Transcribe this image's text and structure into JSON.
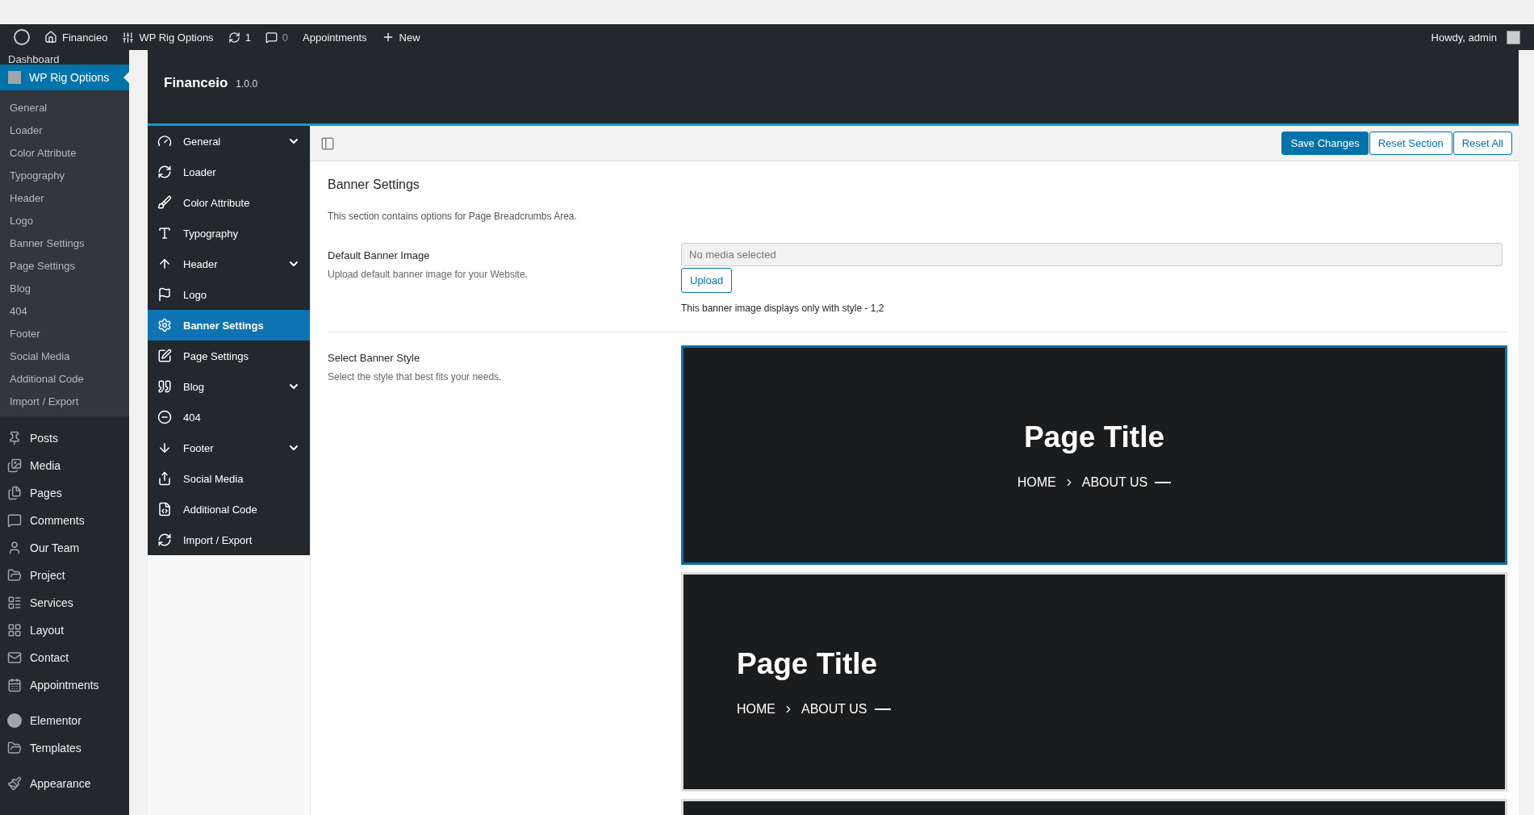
{
  "admin_bar": {
    "site": "Financieo",
    "plugin": "WP Rig Options",
    "updates": "1",
    "comments": "0",
    "appointments": "Appointments",
    "new": "New",
    "greeting": "Howdy, admin"
  },
  "wp_menu": {
    "top_item": "Dashboard",
    "current": {
      "label": "WP Rig Options",
      "selected": true
    },
    "submenu": [
      "General",
      "Loader",
      "Color Attribute",
      "Typography",
      "Header",
      "Logo",
      "Banner Settings",
      "Page Settings",
      "Blog",
      "404",
      "Footer",
      "Social Media",
      "Additional Code",
      "Import / Export"
    ],
    "groups": [
      [
        {
          "label": "Posts",
          "selected": false
        },
        {
          "label": "Media",
          "selected": false
        },
        {
          "label": "Pages",
          "selected": false
        },
        {
          "label": "Comments",
          "selected": false
        },
        {
          "label": "Our Team",
          "selected": false
        },
        {
          "label": "Project",
          "selected": false
        },
        {
          "label": "Services",
          "selected": false
        },
        {
          "label": "Layout",
          "selected": false
        },
        {
          "label": "Contact",
          "selected": false
        },
        {
          "label": "Appointments",
          "selected": false
        }
      ],
      [
        {
          "label": "Elementor",
          "selected": false
        },
        {
          "label": "Templates",
          "selected": false
        }
      ],
      [
        {
          "label": "Appearance",
          "selected": false
        }
      ]
    ]
  },
  "options_header": {
    "title": "Financeio",
    "version": "1.0.0"
  },
  "options_nav": [
    {
      "label": "General",
      "selected": false,
      "expandable": true
    },
    {
      "label": "Loader",
      "selected": false,
      "expandable": false
    },
    {
      "label": "Color Attribute",
      "selected": false,
      "expandable": false
    },
    {
      "label": "Typography",
      "selected": false,
      "expandable": false
    },
    {
      "label": "Header",
      "selected": false,
      "expandable": true
    },
    {
      "label": "Logo",
      "selected": false,
      "expandable": false
    },
    {
      "label": "Banner Settings",
      "selected": true,
      "expandable": false
    },
    {
      "label": "Page Settings",
      "selected": false,
      "expandable": false
    },
    {
      "label": "Blog",
      "selected": false,
      "expandable": true
    },
    {
      "label": "404",
      "selected": false,
      "expandable": false
    },
    {
      "label": "Footer",
      "selected": false,
      "expandable": true
    },
    {
      "label": "Social Media",
      "selected": false,
      "expandable": false
    },
    {
      "label": "Additional Code",
      "selected": false,
      "expandable": false
    },
    {
      "label": "Import / Export",
      "selected": false,
      "expandable": false
    }
  ],
  "toolbar": {
    "buttons": [
      {
        "label": "Save Changes",
        "kind": "primary"
      },
      {
        "label": "Reset Section",
        "kind": "secondary"
      },
      {
        "label": "Reset All",
        "kind": "secondary"
      }
    ]
  },
  "section": {
    "title": "Banner Settings",
    "description": "This section contains options for Page Breadcrumbs Area.",
    "fields": [
      {
        "kind": "media",
        "label": "Default Banner Image",
        "description": "Upload default banner image for your Website.",
        "placeholder": "No media selected",
        "button": "Upload",
        "note": "This banner image displays only with style - 1,2"
      },
      {
        "kind": "styles",
        "label": "Select Banner Style",
        "description": "Select the style that best fits your needs.",
        "styles": [
          {
            "centered": true,
            "selected": true,
            "title": "Page Title",
            "crumbs": [
              "HOME",
              "ABOUT US"
            ]
          },
          {
            "centered": false,
            "selected": false,
            "title": "Page Title",
            "crumbs": [
              "HOME",
              "ABOUT US"
            ]
          },
          {
            "selected": false
          }
        ]
      }
    ]
  }
}
